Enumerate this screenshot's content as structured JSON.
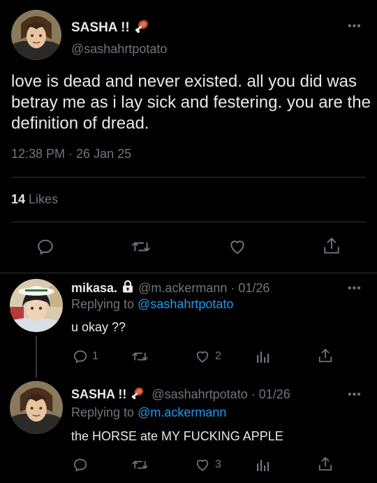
{
  "main": {
    "display_name": "SASHA !!",
    "name_emoji": "meat-on-bone-emoji",
    "handle": "@sashahrtpotato",
    "more_label": "•••",
    "text": "love is dead and never existed. all you did was betray me as i lay sick and festering. you are the definition of dread.",
    "timestamp": "12:38 PM · 26 Jan 25",
    "likes_count": "14",
    "likes_label": "Likes",
    "actions": [
      "reply-icon",
      "retweet-icon",
      "like-icon",
      "share-icon"
    ]
  },
  "replies": [
    {
      "display_name": "mikasa.",
      "badge": "lock-icon",
      "meta": "@m.ackermann · 01/26",
      "replying_prefix": "Replying to",
      "replying_to": "@sashahrtpotato",
      "text": "u okay ??",
      "reply_count": "1",
      "retweet_count": "",
      "like_count": "2",
      "more_label": "•••"
    },
    {
      "display_name": "SASHA !!",
      "badge": "meat-on-bone-emoji",
      "meta": "@sashahrtpotato · 01/26",
      "replying_prefix": "Replying to",
      "replying_to": "@m.ackermann",
      "text": "the HORSE ate MY FUCKING APPLE",
      "reply_count": "",
      "retweet_count": "",
      "like_count": "3",
      "more_label": "•••"
    }
  ],
  "colors": {
    "background": "#000000",
    "text": "#e7e9ea",
    "muted": "#71767b",
    "link": "#1d9bf0",
    "divider": "#2f3336"
  }
}
